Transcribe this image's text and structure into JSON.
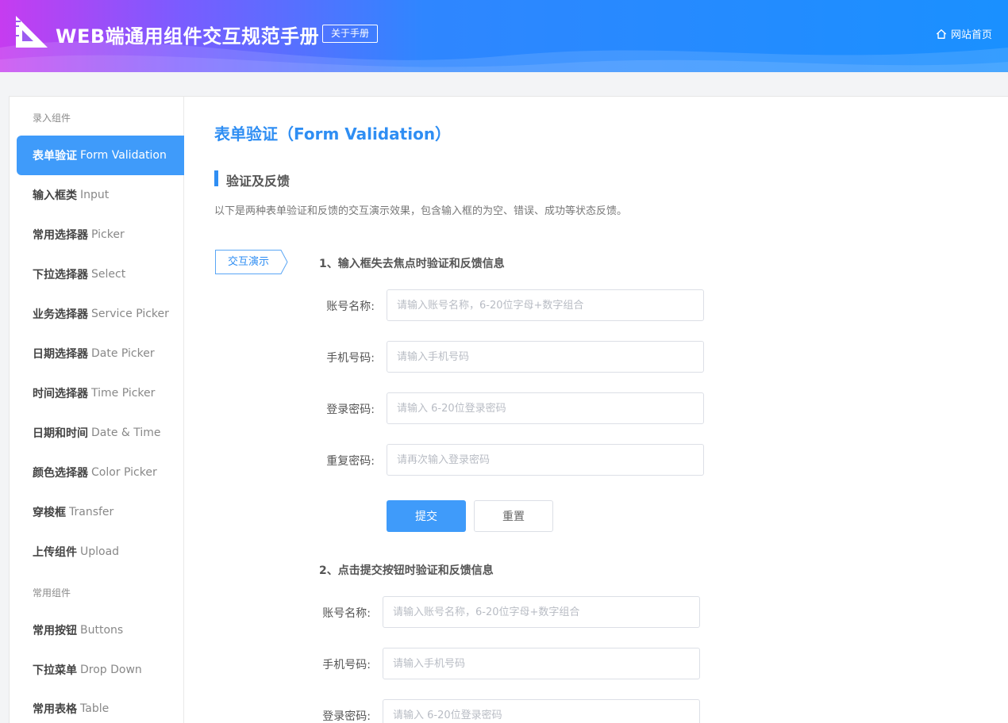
{
  "header": {
    "title": "WEB端通用组件交互规范手册",
    "about_label": "关于手册",
    "home_label": "网站首页",
    "home_icon": "home-icon",
    "logo_icon": "ruler-triangle-logo"
  },
  "sidebar": {
    "groups": [
      {
        "label": "录入组件",
        "items": [
          {
            "zh": "表单验证",
            "en": "Form Validation",
            "active": true
          },
          {
            "zh": "输入框类",
            "en": "Input"
          },
          {
            "zh": "常用选择器",
            "en": "Picker"
          },
          {
            "zh": "下拉选择器",
            "en": "Select"
          },
          {
            "zh": "业务选择器",
            "en": "Service Picker"
          },
          {
            "zh": "日期选择器",
            "en": "Date Picker"
          },
          {
            "zh": "时间选择器",
            "en": "Time Picker"
          },
          {
            "zh": "日期和时间",
            "en": "Date & Time"
          },
          {
            "zh": "颜色选择器",
            "en": "Color Picker"
          },
          {
            "zh": "穿梭框",
            "en": "Transfer"
          },
          {
            "zh": "上传组件",
            "en": "Upload"
          }
        ]
      },
      {
        "label": "常用组件",
        "items": [
          {
            "zh": "常用按钮",
            "en": "Buttons"
          },
          {
            "zh": "下拉菜单",
            "en": "Drop Down"
          },
          {
            "zh": "常用表格",
            "en": "Table"
          }
        ]
      }
    ]
  },
  "main": {
    "page_title": "表单验证（Form Validation）",
    "section_title": "验证及反馈",
    "section_desc": "以下是两种表单验证和反馈的交互演示效果，包含输入框的为空、错误、成功等状态反馈。",
    "demo_tag": "交互演示",
    "form1": {
      "title": "1、输入框失去焦点时验证和反馈信息",
      "fields": [
        {
          "label": "账号名称:",
          "placeholder": "请输入账号名称，6-20位字母+数字组合",
          "value": ""
        },
        {
          "label": "手机号码:",
          "placeholder": "请输入手机号码",
          "value": ""
        },
        {
          "label": "登录密码:",
          "placeholder": "请输入 6-20位登录密码",
          "value": ""
        },
        {
          "label": "重复密码:",
          "placeholder": "请再次输入登录密码",
          "value": ""
        }
      ],
      "submit_label": "提交",
      "reset_label": "重置"
    },
    "form2": {
      "title": "2、点击提交按钮时验证和反馈信息",
      "fields": [
        {
          "label": "账号名称:",
          "placeholder": "请输入账号名称，6-20位字母+数字组合",
          "value": ""
        },
        {
          "label": "手机号码:",
          "placeholder": "请输入手机号码",
          "value": ""
        },
        {
          "label": "登录密码:",
          "placeholder": "请输入 6-20位登录密码",
          "value": ""
        }
      ]
    }
  },
  "colors": {
    "accent": "#3f9bfa",
    "title_blue": "#2f8ef3",
    "header_start": "#c63cf0",
    "header_end": "#1a90ff"
  }
}
